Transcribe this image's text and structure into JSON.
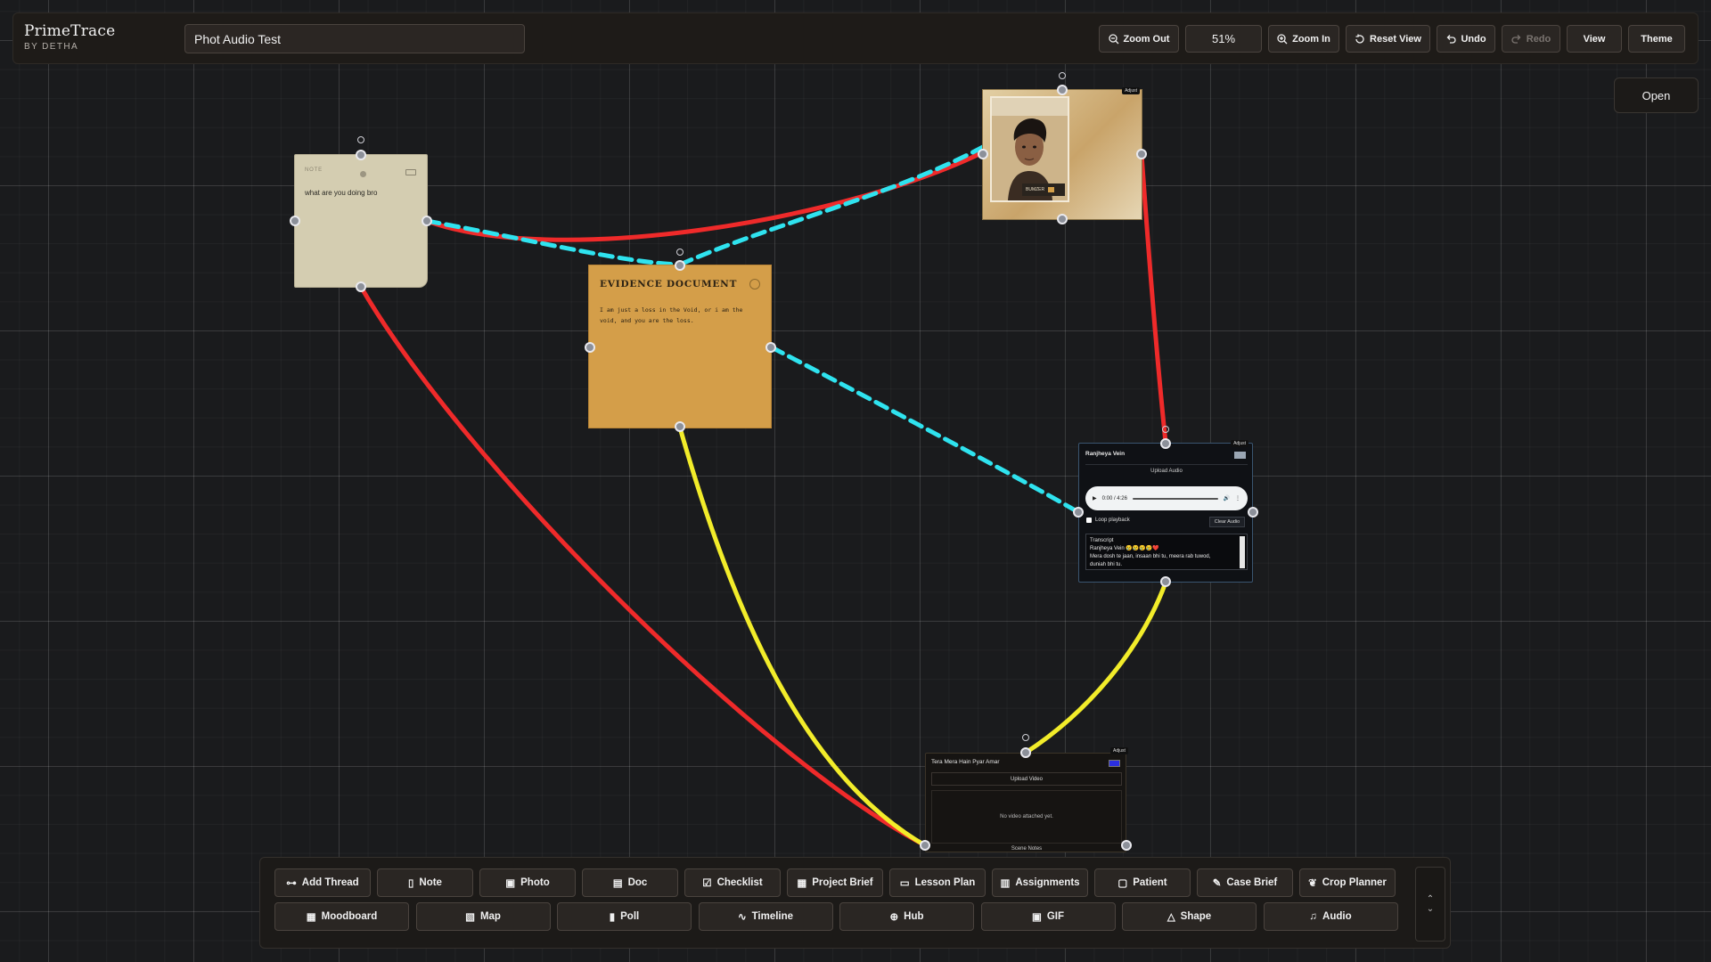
{
  "app": {
    "name": "PrimeTrace",
    "byline": "BY DETHA"
  },
  "board_title": "Phot Audio Test",
  "header": {
    "zoom_out": "Zoom Out",
    "zoom_value": "51%",
    "zoom_in": "Zoom In",
    "reset_view": "Reset View",
    "undo": "Undo",
    "redo": "Redo",
    "view": "View",
    "theme": "Theme"
  },
  "open_button": "Open",
  "note_card": {
    "label": "NOTE",
    "text": "what are you doing bro"
  },
  "evidence_card": {
    "title": "EVIDENCE DOCUMENT",
    "text": "I am just a loss in the Void, or i am the void, and you are the loss."
  },
  "photo_card": {
    "caption": "BUMZER",
    "adjust": "Adjust"
  },
  "audio_card": {
    "title": "Ranjheya Vein",
    "upload": "Upload Audio",
    "time": "0:00 / 4:26",
    "loop": "Loop playback",
    "clear": "Clear Audio",
    "adjust": "Adjust",
    "transcript_label": "Transcript",
    "transcript_line1": "Ranjheya Vein 😢😢😢😢❤️",
    "transcript_line2": "Mera dosh te jaan, insaan bhi tu, meera rab tuwod,",
    "transcript_line3": "duniah bhi tu."
  },
  "video_card": {
    "title": "Tera Mera Hain Pyar Amar",
    "upload": "Upload Video",
    "empty": "No video attached yet.",
    "notes": "Scene Notes",
    "adjust": "Adjust"
  },
  "colors": {
    "red_thread": "#ef2a2a",
    "cyan_thread": "#2fe3ef",
    "yellow_thread": "#f2ec2a"
  },
  "toolbar": {
    "row1": [
      "Add Thread",
      "Note",
      "Photo",
      "Doc",
      "Checklist",
      "Project Brief",
      "Lesson Plan",
      "Assignments",
      "Patient",
      "Case Brief",
      "Crop Planner"
    ],
    "row2": [
      "Moodboard",
      "Map",
      "Poll",
      "Timeline",
      "Hub",
      "GIF",
      "Shape",
      "Audio"
    ],
    "row1_icons": [
      "thread-icon",
      "note-icon",
      "photo-icon",
      "doc-icon",
      "checklist-icon",
      "briefcase-icon",
      "book-icon",
      "clipboard-icon",
      "patient-icon",
      "pen-icon",
      "leaf-icon"
    ],
    "row2_icons": [
      "grid-icon",
      "map-icon",
      "poll-icon",
      "timeline-icon",
      "hub-icon",
      "gif-icon",
      "shape-icon",
      "music-icon"
    ]
  }
}
